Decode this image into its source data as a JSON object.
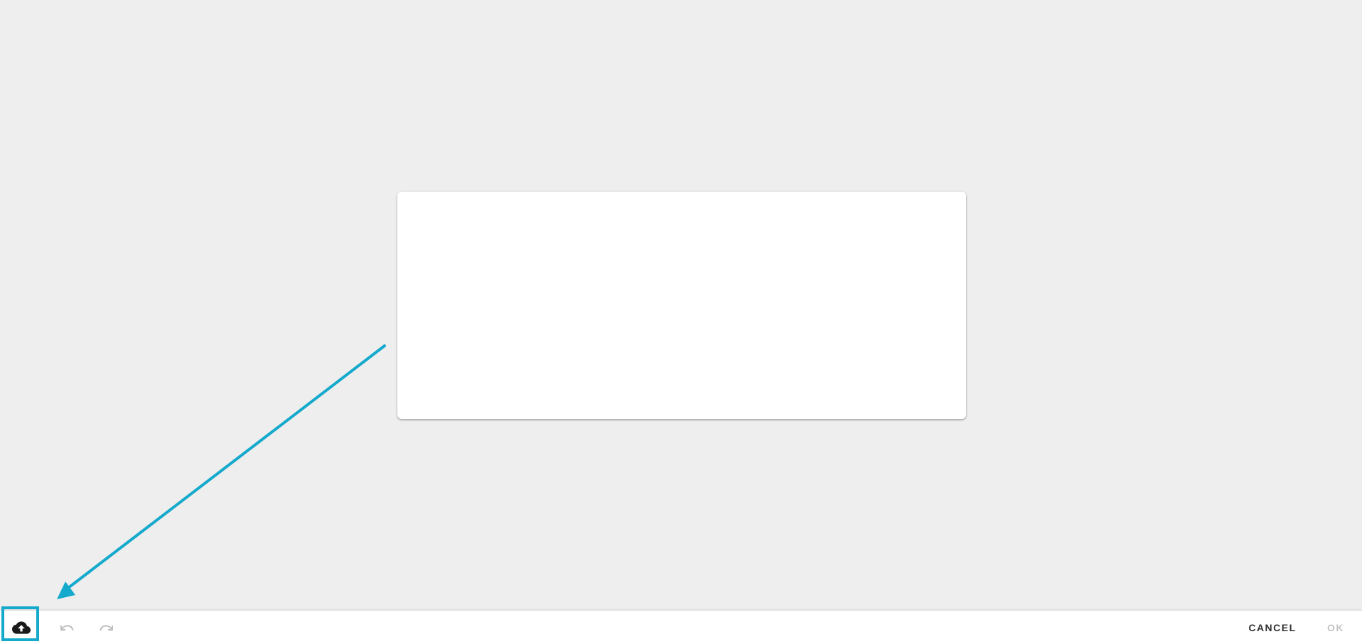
{
  "editor": {
    "canvas": "blank"
  },
  "toolbar": {
    "upload_icon": "cloud-upload-icon",
    "undo_icon": "undo-icon",
    "redo_icon": "redo-icon",
    "cancel_label": "CANCEL",
    "ok_label": "OK"
  },
  "annotation": {
    "color": "#15a9cc",
    "type": "arrow-to-highlight"
  },
  "colors": {
    "background": "#eeeeee",
    "card": "#ffffff",
    "icon_active": "#1a1a1a",
    "icon_disabled": "#bdbdbd",
    "ok_disabled": "#c4c4c4"
  }
}
